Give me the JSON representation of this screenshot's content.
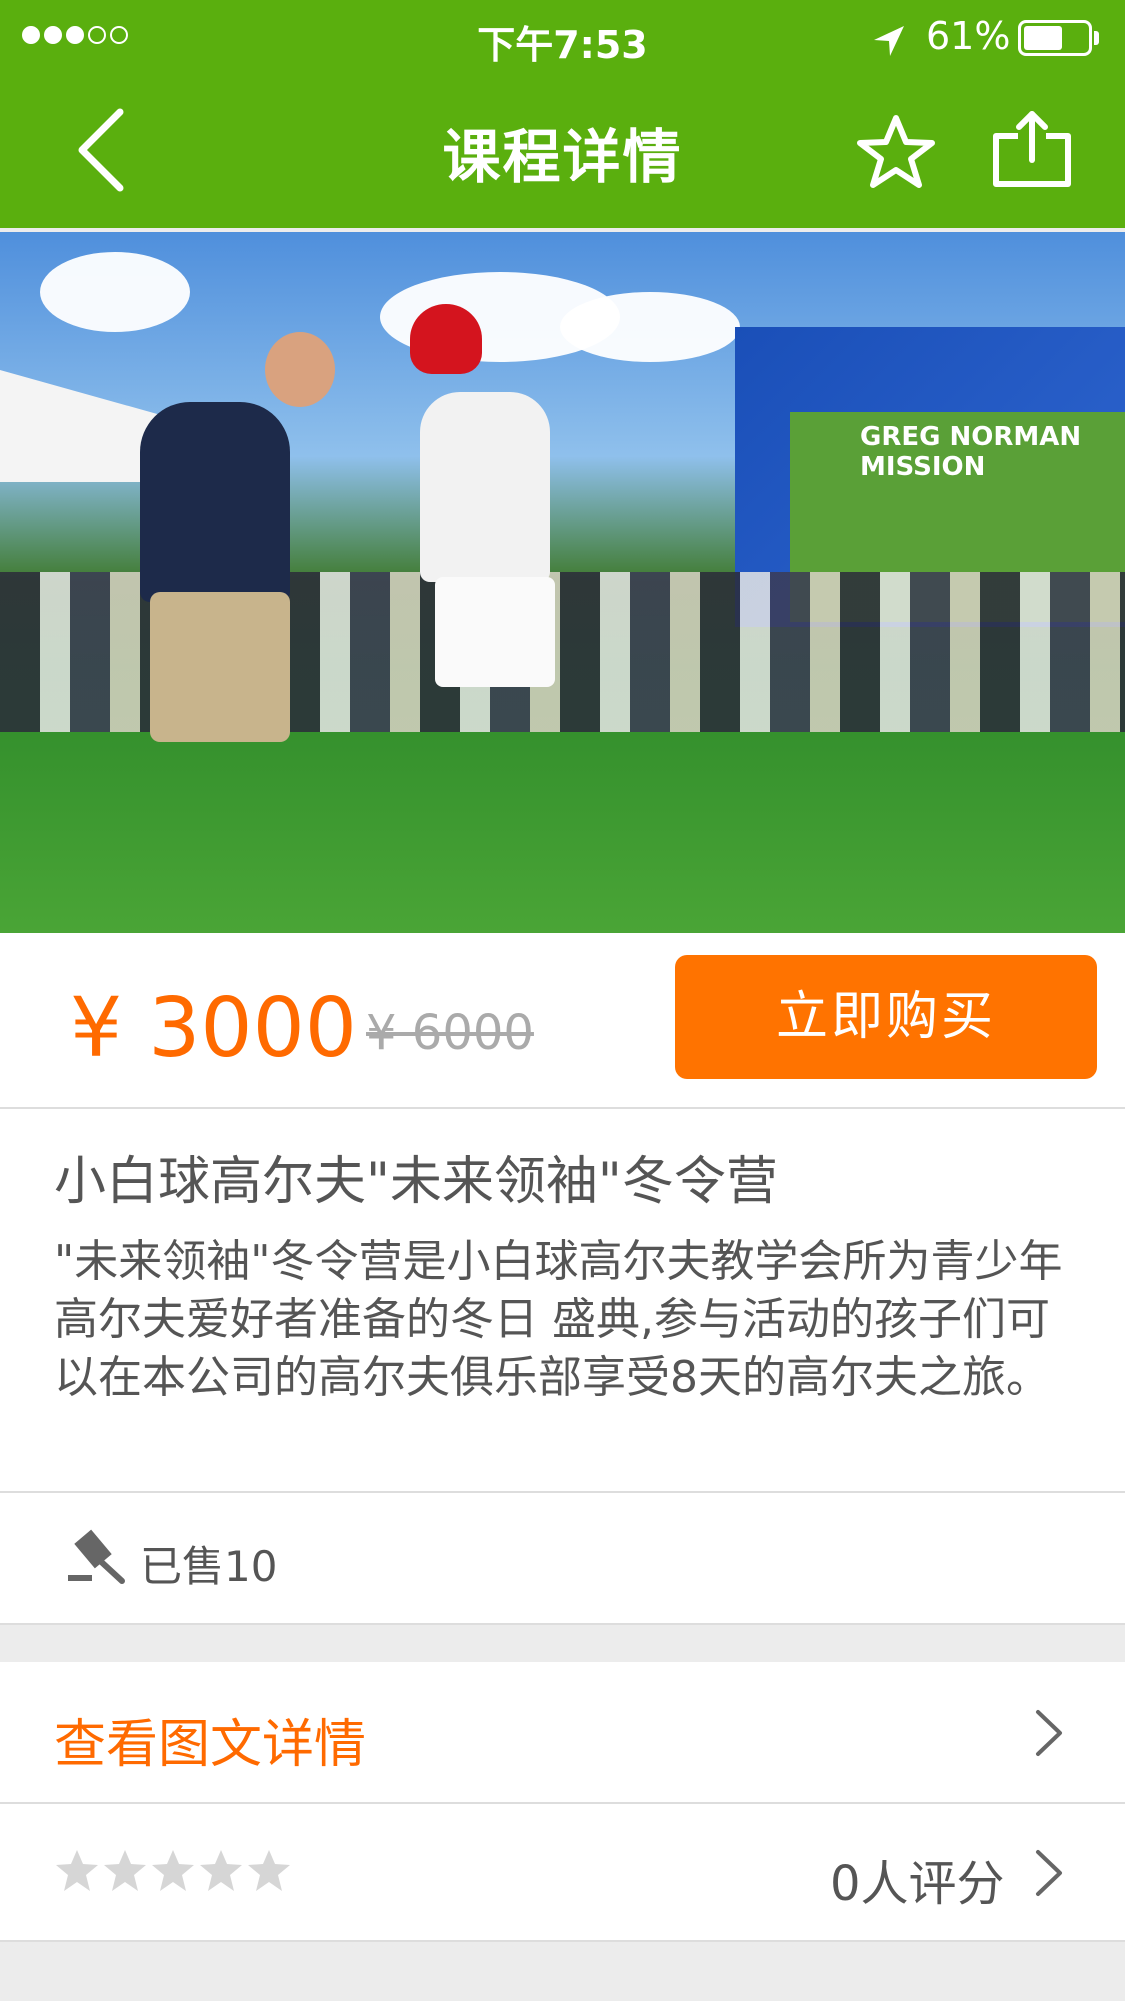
{
  "status_bar": {
    "time": "下午7:53",
    "battery": "61%",
    "battery_level": 0.61,
    "signal_dots_filled": 3,
    "signal_dots_total": 5
  },
  "nav": {
    "title": "课程详情",
    "back_icon": "chevron-left-icon",
    "favorite_icon": "star-outline-icon",
    "share_icon": "share-icon"
  },
  "hero": {
    "banner_text": "GREG NORMAN MISSION",
    "slides_total": 8,
    "active_slide": 1
  },
  "price": {
    "current": "¥ 3000",
    "original": "¥ 6000",
    "buy_label": "立即购买"
  },
  "course": {
    "title": "小白球高尔夫\"未来领袖\"冬令营",
    "description": "\"未来领袖\"冬令营是小白球高尔夫教学会所为青少年高尔夫爱好者准备的冬日  盛典,参与活动的孩子们可以在本公司的高尔夫俱乐部享受8天的高尔夫之旅。"
  },
  "sales": {
    "sold_text": "已售10"
  },
  "detail_link": {
    "label": "查看图文详情"
  },
  "rating": {
    "stars_filled": 0,
    "stars_total": 5,
    "count_text": "0人评分"
  },
  "colors": {
    "nav_green": "#5aaf0e",
    "accent_orange": "#ff7300"
  }
}
